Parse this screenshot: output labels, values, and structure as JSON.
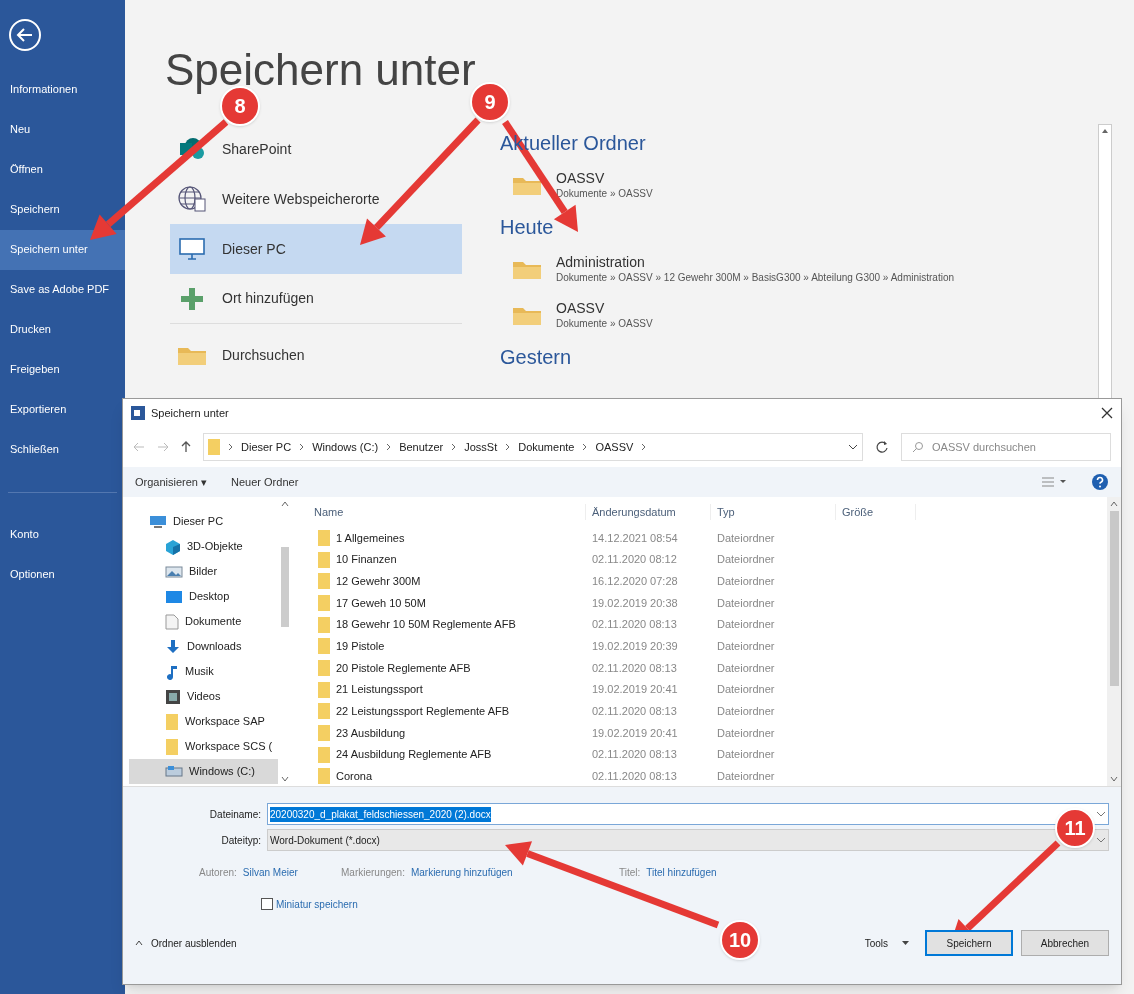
{
  "sidebar": {
    "items": [
      {
        "label": "Informationen",
        "selected": false
      },
      {
        "label": "Neu",
        "selected": false
      },
      {
        "label": "Öffnen",
        "selected": false
      },
      {
        "label": "Speichern",
        "selected": false
      },
      {
        "label": "Speichern unter",
        "selected": true
      },
      {
        "label": "Save as Adobe PDF",
        "selected": false
      },
      {
        "label": "Drucken",
        "selected": false
      },
      {
        "label": "Freigeben",
        "selected": false
      },
      {
        "label": "Exportieren",
        "selected": false
      },
      {
        "label": "Schließen",
        "selected": false
      },
      {
        "label": "Konto",
        "selected": false,
        "kind": "group2"
      },
      {
        "label": "Optionen",
        "selected": false,
        "kind": "group2"
      }
    ]
  },
  "backstage": {
    "title": "Speichern unter",
    "places": [
      {
        "label": "SharePoint",
        "kind": "sharepoint",
        "selected": false
      },
      {
        "label": "Weitere Webspeicherorte",
        "kind": "globe",
        "selected": false
      },
      {
        "label": "Dieser PC",
        "kind": "pc",
        "selected": true
      },
      {
        "label": "Ort hinzufügen",
        "kind": "plus",
        "selected": false
      },
      {
        "label": "Durchsuchen",
        "kind": "folder",
        "selected": false
      }
    ],
    "sections": [
      {
        "heading": "Aktueller Ordner",
        "items": [
          {
            "name": "OASSV",
            "path": "Dokumente » OASSV"
          }
        ]
      },
      {
        "heading": "Heute",
        "items": [
          {
            "name": "Administration",
            "path": "Dokumente » OASSV » 12 Gewehr 300M » BasisG300 » Abteilung G300 » Administration"
          },
          {
            "name": "OASSV",
            "path": "Dokumente » OASSV"
          }
        ]
      },
      {
        "heading": "Gestern"
      }
    ]
  },
  "dialog": {
    "title": "Speichern unter",
    "breadcrumb": [
      "Dieser PC",
      "Windows (C:)",
      "Benutzer",
      "JossSt",
      "Dokumente",
      "OASSV"
    ],
    "search": {
      "placeholder": "OASSV durchsuchen"
    },
    "toolbar": [
      "Organisieren ▾",
      "Neuer Ordner"
    ],
    "nav": [
      {
        "label": "Dieser PC",
        "kind": "pc",
        "selected": false
      },
      {
        "label": "3D-Objekte",
        "kind": "cube",
        "selected": false
      },
      {
        "label": "Bilder",
        "kind": "pictures",
        "selected": false
      },
      {
        "label": "Desktop",
        "kind": "desktop",
        "selected": false
      },
      {
        "label": "Dokumente",
        "kind": "document",
        "selected": false
      },
      {
        "label": "Downloads",
        "kind": "download",
        "selected": false
      },
      {
        "label": "Musik",
        "kind": "music",
        "selected": false
      },
      {
        "label": "Videos",
        "kind": "video",
        "selected": false
      },
      {
        "label": "Workspace SAP",
        "kind": "folder",
        "selected": false
      },
      {
        "label": "Workspace SCS (",
        "kind": "folder",
        "selected": false
      },
      {
        "label": "Windows (C:)",
        "kind": "drive",
        "selected": true
      }
    ],
    "columns": [
      "Name",
      "Änderungsdatum",
      "Typ",
      "Größe"
    ],
    "rows": [
      {
        "name": "1 Allgemeines",
        "date": "14.12.2021 08:54",
        "type": "Dateiordner"
      },
      {
        "name": "10 Finanzen",
        "date": "02.11.2020 08:12",
        "type": "Dateiordner"
      },
      {
        "name": "12 Gewehr 300M",
        "date": "16.12.2020 07:28",
        "type": "Dateiordner"
      },
      {
        "name": "17 Geweh 10 50M",
        "date": "19.02.2019 20:38",
        "type": "Dateiordner"
      },
      {
        "name": "18 Gewehr 10 50M Reglemente AFB",
        "date": "02.11.2020 08:13",
        "type": "Dateiordner"
      },
      {
        "name": "19 Pistole",
        "date": "19.02.2019 20:39",
        "type": "Dateiordner"
      },
      {
        "name": "20 Pistole Reglemente AFB",
        "date": "02.11.2020 08:13",
        "type": "Dateiordner"
      },
      {
        "name": "21 Leistungssport",
        "date": "19.02.2019 20:41",
        "type": "Dateiordner"
      },
      {
        "name": "22 Leistungssport Reglemente AFB",
        "date": "02.11.2020 08:13",
        "type": "Dateiordner"
      },
      {
        "name": "23 Ausbildung",
        "date": "19.02.2019 20:41",
        "type": "Dateiordner"
      },
      {
        "name": "24 Ausbildung Reglemente AFB",
        "date": "02.11.2020 08:13",
        "type": "Dateiordner"
      },
      {
        "name": "Corona",
        "date": "02.11.2020 08:13",
        "type": "Dateiordner"
      }
    ],
    "filename": {
      "label": "Dateiname:",
      "value": "20200320_d_plakat_feldschiessen_2020 (2).docx"
    },
    "filetype": {
      "label": "Dateityp:",
      "value": "Word-Dokument (*.docx)"
    },
    "meta": [
      {
        "label": "Autoren:",
        "value": "Silvan Meier"
      },
      {
        "label": "Markierungen:",
        "value": "Markierung hinzufügen"
      },
      {
        "label": "Titel:",
        "value": "Titel hinzufügen"
      }
    ],
    "thumbnail": {
      "label": "Miniatur speichern",
      "checked": false
    },
    "hide_folders": "Ordner ausblenden",
    "tools": "Tools",
    "buttons": [
      "Speichern",
      "Abbrechen"
    ]
  },
  "callouts": [
    {
      "label": "8"
    },
    {
      "label": "9"
    },
    {
      "label": "10"
    },
    {
      "label": "11"
    }
  ]
}
